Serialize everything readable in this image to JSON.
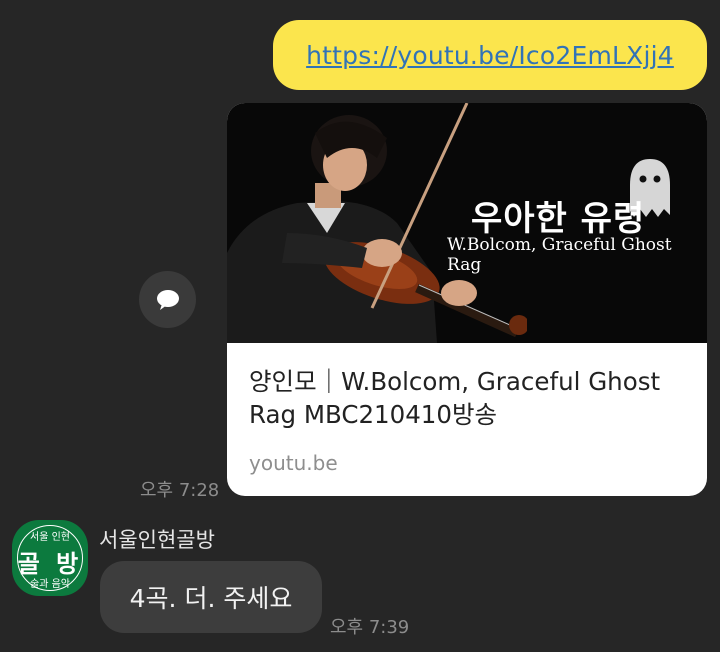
{
  "outgoing": {
    "link_text": "https://youtu.be/Ico2EmLXjj4",
    "preview": {
      "thumb_title": "우아한 유령",
      "thumb_subtitle": "W.Bolcom, Graceful Ghost Rag",
      "title": "양인모｜W.Bolcom, Graceful Ghost Rag  MBC210410방송",
      "domain": "youtu.be"
    },
    "time": "오후 7:28",
    "share_icon": "speech-bubble-icon"
  },
  "incoming": {
    "sender": "서울인현골방",
    "avatar": {
      "top_text": "서울 인현",
      "main_text": "골 방",
      "bottom_text": "술과 음악",
      "color": "#0c7a3e"
    },
    "message": "4곡. 더. 주세요",
    "time": "오후 7:39"
  },
  "colors": {
    "background": "#262626",
    "outgoing_bubble": "#fbe54d",
    "link": "#3173b7",
    "incoming_bubble": "#3d3d3d"
  }
}
